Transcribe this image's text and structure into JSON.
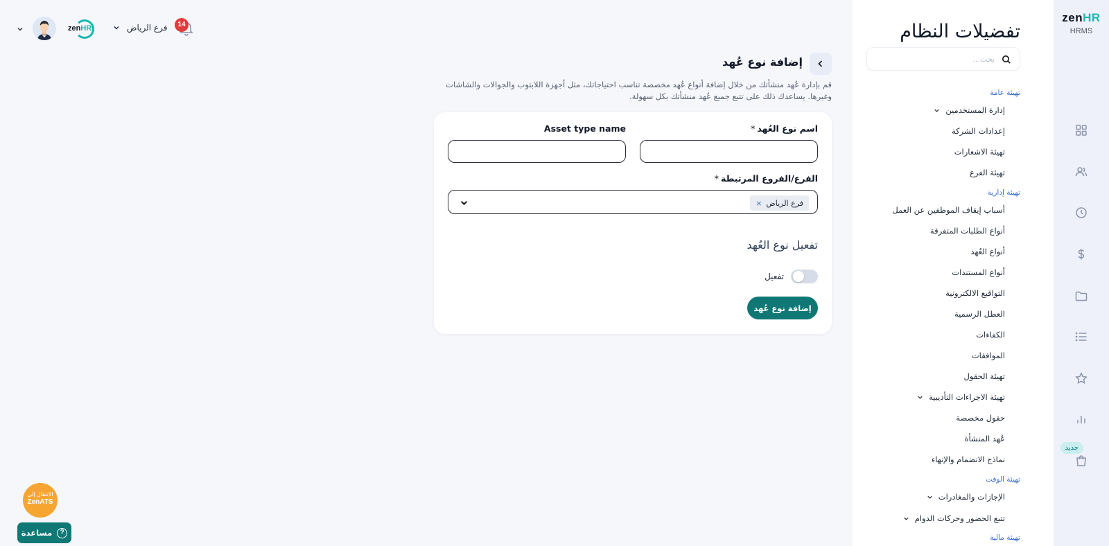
{
  "app": {
    "brand": "zenHR",
    "brand_sub": "HRMS",
    "small_logo": "zenHR"
  },
  "rail": {
    "icons": [
      "grid-icon",
      "users-icon",
      "clock-icon",
      "dollar-icon",
      "folder-icon",
      "list-icon",
      "star-icon",
      "bar-chart-icon",
      "shopping-bag-icon"
    ],
    "new_badge": "جديد"
  },
  "topbar": {
    "notifications_count": "14",
    "branch_label": "فرع الرياض"
  },
  "sidebar": {
    "title": "تفضيلات النظام",
    "search_placeholder": "بحث...",
    "sections": [
      {
        "heading": "تهيئة عامة",
        "items": [
          {
            "label": "إدارة المستخدمين",
            "expandable": true
          },
          {
            "label": "إعدادات الشركة",
            "expandable": false
          },
          {
            "label": "تهيئة الاشعارات",
            "expandable": false
          },
          {
            "label": "تهيئة الفرع",
            "expandable": false
          }
        ]
      },
      {
        "heading": "تهيئة إدارية",
        "items": [
          {
            "label": "أسباب إيقاف الموظفين عن العمل",
            "expandable": false
          },
          {
            "label": "أنواع الطلبات المتفرقة",
            "expandable": false
          },
          {
            "label": "أنواع العُهد",
            "expandable": false
          },
          {
            "label": "أنواع المستندات",
            "expandable": false
          },
          {
            "label": "التواقيع الالكترونية",
            "expandable": false
          },
          {
            "label": "العطل الرسمية",
            "expandable": false
          },
          {
            "label": "الكفاءات",
            "expandable": false
          },
          {
            "label": "الموافقات",
            "expandable": false
          },
          {
            "label": "تهيئة الحقول",
            "expandable": false
          },
          {
            "label": "تهيئة الاجراءات التأديبية",
            "expandable": true
          },
          {
            "label": "حقول مخصصة",
            "expandable": false
          },
          {
            "label": "عُهد المنشأة",
            "expandable": false
          },
          {
            "label": "نماذج الانضمام والإنهاء",
            "expandable": false
          }
        ]
      },
      {
        "heading": "تهيئة الوقت",
        "items": [
          {
            "label": "الإجازات والمغادرات",
            "expandable": true
          },
          {
            "label": "تتبع الحضور وحركات الدوام",
            "expandable": true
          }
        ]
      },
      {
        "heading": "تهيئة مالية",
        "items": []
      }
    ]
  },
  "main": {
    "page_title": "إضافة نوع عُهد",
    "description": "قم بإدارة عُهد منشأتك من خلال إضافة أنواع عُهد مخصصة تناسب احتياجاتك، مثل أجهزة اللابتوب والجوالات والشاشات وغيرها. يساعدك ذلك على تتبع جميع عُهد منشأتك بكل سهولة.",
    "form": {
      "name_ar_label": "اسم نوع العُهد",
      "name_ar_value": "",
      "name_en_label": "Asset type name",
      "name_en_value": "",
      "required_mark": "*",
      "branches_label": "الفرع/الفروع المرتبطة",
      "branches_selected": [
        "فرع الرياض"
      ],
      "chip_remove": "×",
      "activation_heading": "تفعيل نوع العُهد",
      "activation_toggle_label": "تفعيل",
      "activation_enabled": false,
      "submit_label": "إضافة نوع عُهد"
    }
  },
  "widgets": {
    "ats_line1": "الانتقال إلى",
    "ats_line2": "ZenATS",
    "help_label": "مساعدة",
    "help_icon": "?"
  },
  "colors": {
    "primary": "#0f7875",
    "accent_teal": "#19b6b3",
    "link_blue": "#3a6dd1",
    "badge_red": "#e23b3b",
    "ats_orange": "#f7a531"
  }
}
